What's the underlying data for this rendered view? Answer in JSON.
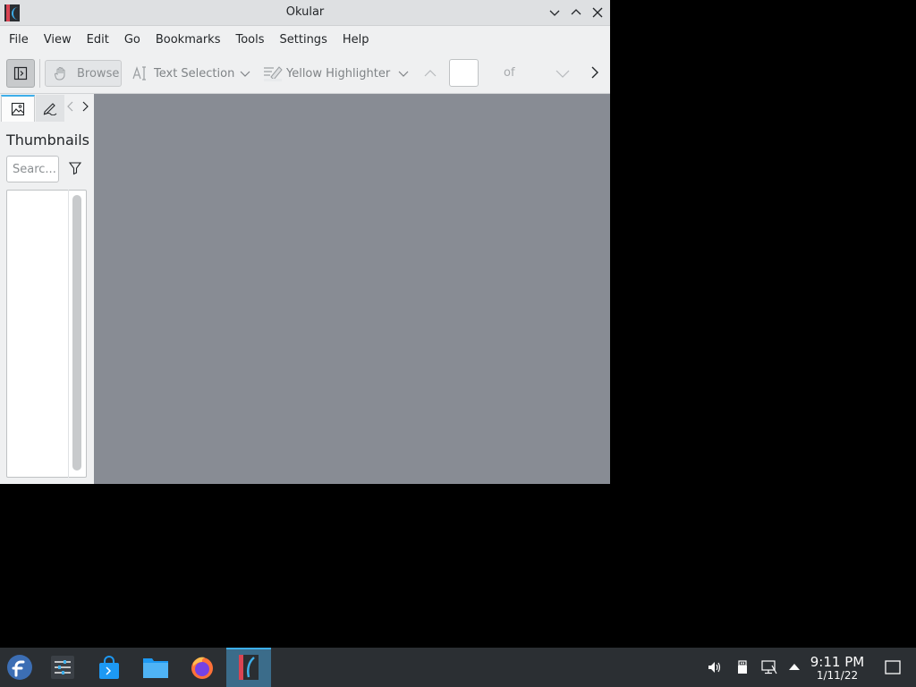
{
  "window": {
    "title": "Okular"
  },
  "menu": [
    "File",
    "Edit",
    "View",
    "Go",
    "Bookmarks",
    "Tools",
    "Settings",
    "Help"
  ],
  "menubar": {
    "file": "File",
    "view": "View",
    "edit": "Edit",
    "go": "Go",
    "bookmarks": "Bookmarks",
    "tools": "Tools",
    "settings": "Settings",
    "help": "Help"
  },
  "toolbar": {
    "browse_label": "Browse",
    "text_selection_label": "Text Selection",
    "highlighter_label": "Yellow Highlighter",
    "page_of_label": "of",
    "page_value": ""
  },
  "sidebar": {
    "title": "Thumbnails",
    "search_placeholder": "Searc..."
  },
  "taskbar": {
    "time": "9:11 PM",
    "date": "1/11/22"
  },
  "colors": {
    "accent": "#3daee9",
    "viewer_bg": "#888c94",
    "taskbar_bg": "#2b2f33"
  }
}
